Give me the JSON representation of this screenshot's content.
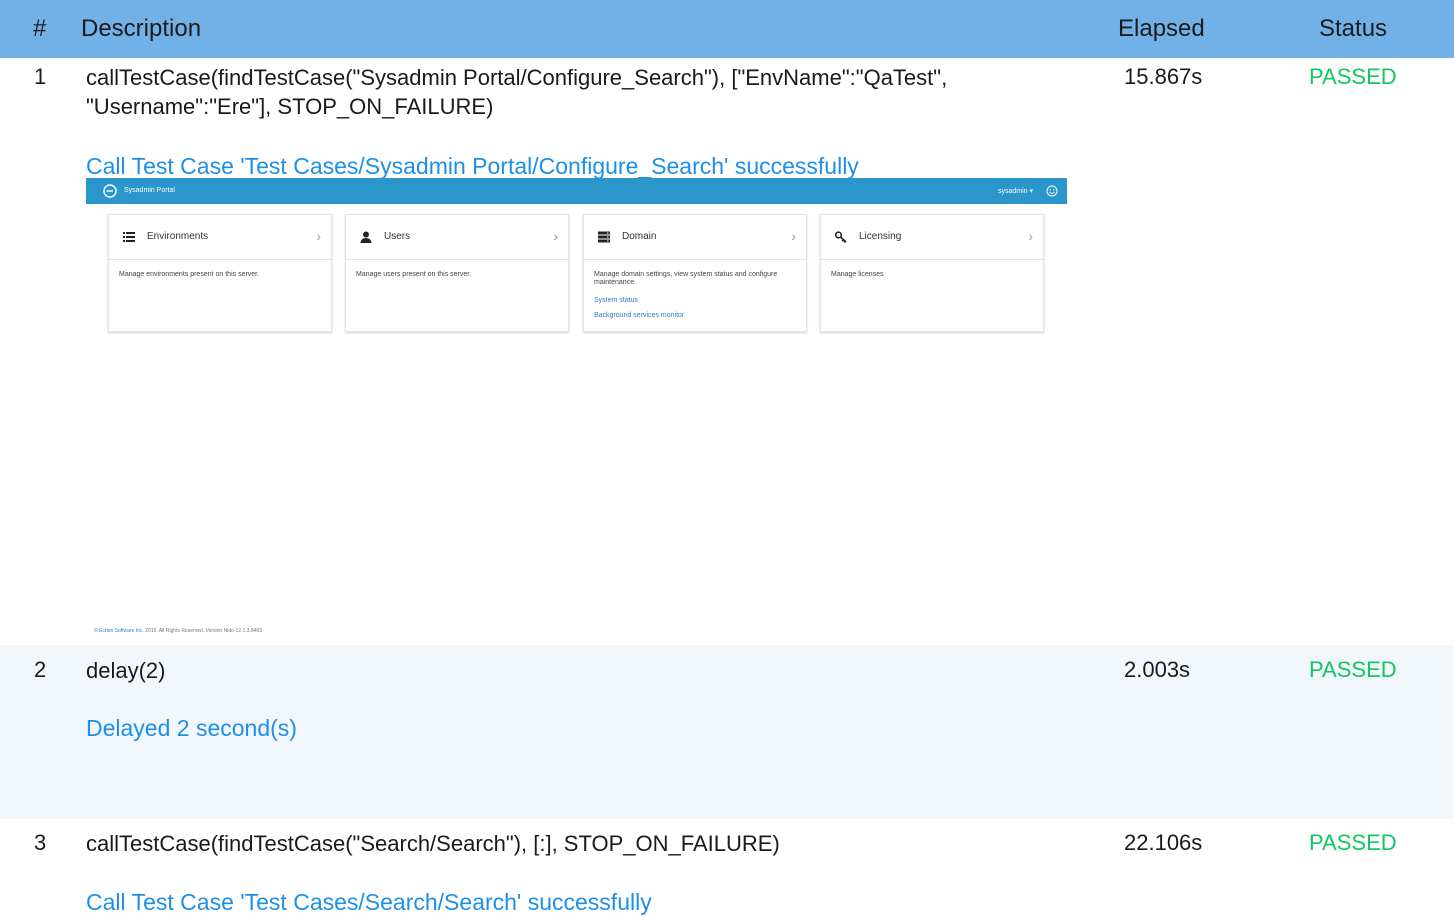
{
  "table": {
    "headers": {
      "num": "#",
      "description": "Description",
      "elapsed": "Elapsed",
      "status": "Status"
    }
  },
  "steps": [
    {
      "num": "1",
      "description": "callTestCase(findTestCase(\"Sysadmin Portal/Configure_Search\"), [\"EnvName\":\"QaTest\", \"Username\":\"Ere\"], STOP_ON_FAILURE)",
      "elapsed": "15.867s",
      "status": "PASSED",
      "message": "Call Test Case 'Test Cases/Sysadmin Portal/Configure_Search' successfully"
    },
    {
      "num": "2",
      "description": "delay(2)",
      "elapsed": "2.003s",
      "status": "PASSED",
      "message": "Delayed 2 second(s)"
    },
    {
      "num": "3",
      "description": "callTestCase(findTestCase(\"Search/Search\"), [:], STOP_ON_FAILURE)",
      "elapsed": "22.106s",
      "status": "PASSED",
      "message": "Call Test Case 'Test Cases/Search/Search' successfully"
    }
  ],
  "screenshot": {
    "nav_title": "Sysadmin Portal",
    "user_menu": "sysadmin ▾",
    "cards": [
      {
        "title": "Environments",
        "icon": "list-icon",
        "description": "Manage environments present on this server.",
        "links": []
      },
      {
        "title": "Users",
        "icon": "user-icon",
        "description": "Manage users present on this server.",
        "links": []
      },
      {
        "title": "Domain",
        "icon": "server-icon",
        "description": "Manage domain settings, view system status and configure maintenance",
        "links": [
          "System status",
          "Background services monitor"
        ]
      },
      {
        "title": "Licensing",
        "icon": "key-icon",
        "description": "Manage licenses",
        "links": []
      }
    ],
    "footer_prefix": "© ",
    "footer_company": "Ecrion Software Inc.",
    "footer_rest": " 2019. All Rights Reserved. Version Nido-12.1.3.8483"
  },
  "colors": {
    "header_bg": "#72b1e7",
    "status_passed": "#13c75f",
    "message_link": "#1d8fe8",
    "portal_nav": "#2b96cc",
    "alt_row": "#f1f7fd"
  }
}
